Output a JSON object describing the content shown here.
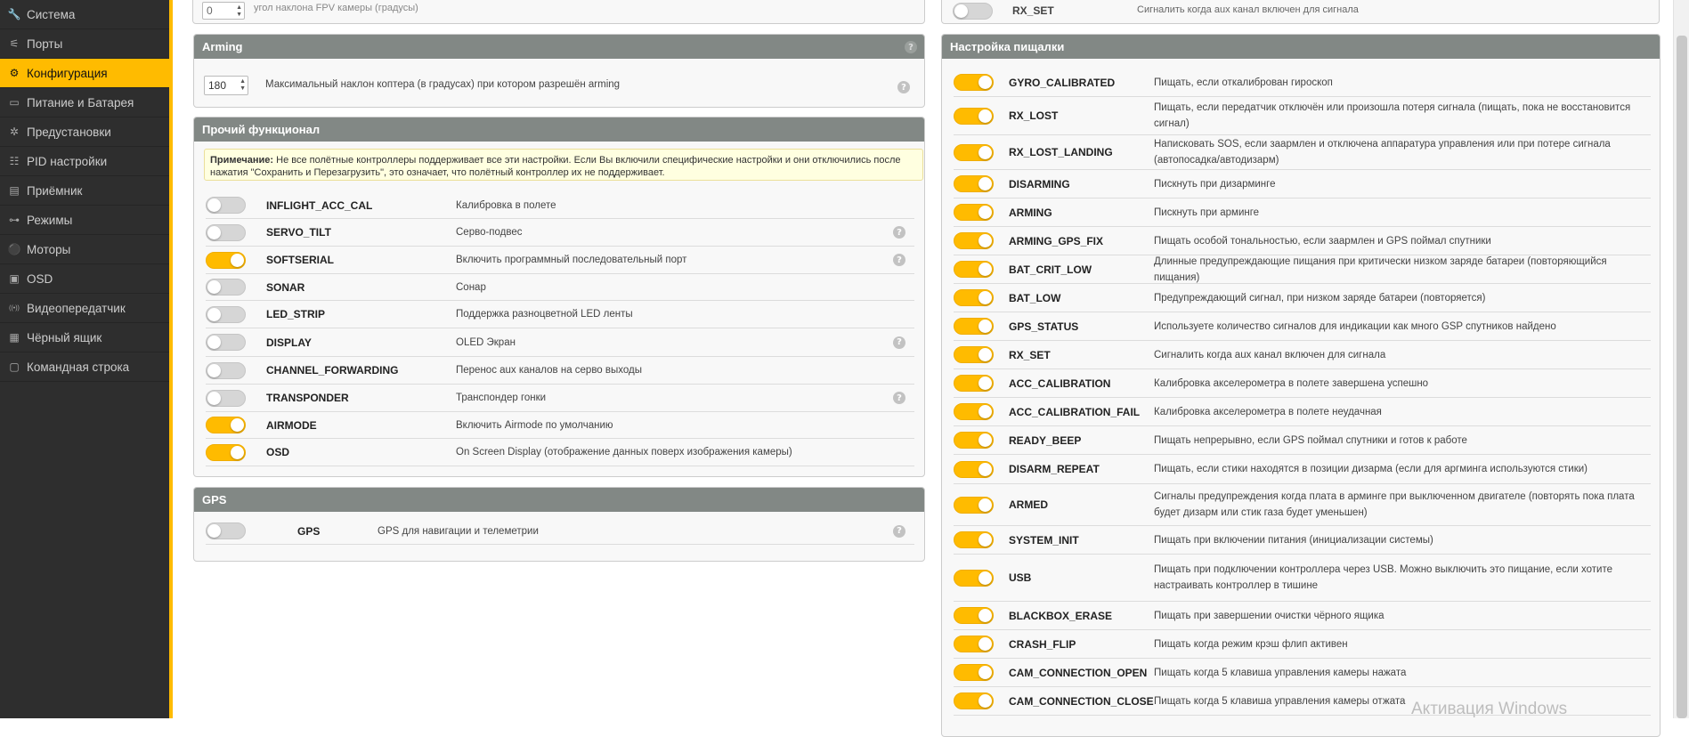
{
  "sidebar": {
    "items": [
      {
        "label": "Система",
        "icon": "wrench-icon"
      },
      {
        "label": "Порты",
        "icon": "plug-icon"
      },
      {
        "label": "Конфигурация",
        "icon": "gear-icon",
        "active": true
      },
      {
        "label": "Питание и Батарея",
        "icon": "battery-icon"
      },
      {
        "label": "Предустановки",
        "icon": "wand-icon"
      },
      {
        "label": "PID настройки",
        "icon": "sliders-icon"
      },
      {
        "label": "Приёмник",
        "icon": "receiver-icon"
      },
      {
        "label": "Режимы",
        "icon": "switch-icon"
      },
      {
        "label": "Моторы",
        "icon": "motor-icon"
      },
      {
        "label": "OSD",
        "icon": "display-icon"
      },
      {
        "label": "Видеопередатчик",
        "icon": "antenna-icon"
      },
      {
        "label": "Чёрный ящик",
        "icon": "blackbox-icon"
      },
      {
        "label": "Командная строка",
        "icon": "terminal-icon"
      }
    ]
  },
  "top_left_cut": {
    "value": "0",
    "text": "угол наклона FPV камеры (градусы)"
  },
  "top_right_cut": {
    "name": "RX_SET",
    "text": "Сигналить когда aux канал включен для сигнала"
  },
  "arming": {
    "title": "Arming",
    "value": "180",
    "label": "Максимальный наклон коптера (в градусах) при котором разрешён arming"
  },
  "features": {
    "title": "Прочий функционал",
    "note_bold": "Примечание:",
    "note_text": " Не все полётные контроллеры поддерживает все эти настройки. Если Вы включили специфические настройки и они отключились после нажатия \"Сохранить и Перезагрузить\", это означает, что полётный контроллер их не поддерживает.",
    "rows": [
      {
        "name": "INFLIGHT_ACC_CAL",
        "desc": "Калибровка в полете",
        "on": false,
        "help": false
      },
      {
        "name": "SERVO_TILT",
        "desc": "Серво-подвес",
        "on": false,
        "help": true
      },
      {
        "name": "SOFTSERIAL",
        "desc": "Включить программный последовательный порт",
        "on": true,
        "help": true
      },
      {
        "name": "SONAR",
        "desc": "Сонар",
        "on": false,
        "help": false
      },
      {
        "name": "LED_STRIP",
        "desc": "Поддержка разноцветной LED ленты",
        "on": false,
        "help": false
      },
      {
        "name": "DISPLAY",
        "desc": "OLED Экран",
        "on": false,
        "help": true
      },
      {
        "name": "CHANNEL_FORWARDING",
        "desc": "Перенос aux каналов на серво выходы",
        "on": false,
        "help": false
      },
      {
        "name": "TRANSPONDER",
        "desc": "Транспондер гонки",
        "on": false,
        "help": true
      },
      {
        "name": "AIRMODE",
        "desc": "Включить Airmode по умолчанию",
        "on": true,
        "help": false
      },
      {
        "name": "OSD",
        "desc": "On Screen Display (отображение данных поверх изображения камеры)",
        "on": true,
        "help": false
      }
    ]
  },
  "gps": {
    "title": "GPS",
    "name": "GPS",
    "desc": "GPS для навигации и телеметрии",
    "on": false
  },
  "beeper": {
    "title": "Настройка пищалки",
    "rows": [
      {
        "name": "GYRO_CALIBRATED",
        "desc": "Пищать, если откалиброван гироскоп",
        "on": true
      },
      {
        "name": "RX_LOST",
        "desc": "Пищать, если передатчик отключён или произошла потеря сигнала (пищать, пока не восстановится сигнал)",
        "on": true
      },
      {
        "name": "RX_LOST_LANDING",
        "desc": "Написковать SOS, если заармлен и отключена аппаратура управления или при потере сигнала (автопосадка/автодизарм)",
        "on": true
      },
      {
        "name": "DISARMING",
        "desc": "Пискнуть при дизарминге",
        "on": true
      },
      {
        "name": "ARMING",
        "desc": "Пискнуть при арминге",
        "on": true
      },
      {
        "name": "ARMING_GPS_FIX",
        "desc": "Пищать особой тональностью, если заармлен и GPS поймал спутники",
        "on": true
      },
      {
        "name": "BAT_CRIT_LOW",
        "desc": "Длинные предупреждающие пищания при критически низком заряде батареи (повторяющийся пищания)",
        "on": true
      },
      {
        "name": "BAT_LOW",
        "desc": "Предупреждающий сигнал, при низком заряде батареи (повторяется)",
        "on": true
      },
      {
        "name": "GPS_STATUS",
        "desc": "Используете количество сигналов для индикации как много GSP спутников найдено",
        "on": true
      },
      {
        "name": "RX_SET",
        "desc": "Сигналить когда aux канал включен для сигнала",
        "on": true
      },
      {
        "name": "ACC_CALIBRATION",
        "desc": "Калибровка акселерометра в полете завершена успешно",
        "on": true
      },
      {
        "name": "ACC_CALIBRATION_FAIL",
        "desc": "Калибровка акселерометра в полете неудачная",
        "on": true
      },
      {
        "name": "READY_BEEP",
        "desc": "Пищать непрерывно, если GPS поймал спутники и готов к работе",
        "on": true
      },
      {
        "name": "DISARM_REPEAT",
        "desc": "Пищать, если стики находятся в позиции дизарма (если для аргминга используются стики)",
        "on": true
      },
      {
        "name": "ARMED",
        "desc": "Сигналы предупреждения когда плата в арминге при выключенном двигателе (повторять пока плата будет дизарм или стик газа будет уменьшен)",
        "on": true
      },
      {
        "name": "SYSTEM_INIT",
        "desc": "Пищать при включении питания (инициализации системы)",
        "on": true
      },
      {
        "name": "USB",
        "desc": "Пищать при подключении контроллера через USB. Можно выключить это пищание, если хотите настраивать контроллер в тишине",
        "on": true
      },
      {
        "name": "BLACKBOX_ERASE",
        "desc": "Пищать при завершении очистки чёрного ящика",
        "on": true
      },
      {
        "name": "CRASH_FLIP",
        "desc": "Пищать когда режим крэш флип активен",
        "on": true
      },
      {
        "name": "CAM_CONNECTION_OPEN",
        "desc": "Пищать когда 5 клавиша управления камеры нажата",
        "on": true
      },
      {
        "name": "CAM_CONNECTION_CLOSE",
        "desc": "Пищать когда 5 клавиша управления камеры отжата",
        "on": true
      }
    ]
  },
  "help_glyph": "?",
  "watermark": "Активация Windows",
  "colors": {
    "accent": "#ffbb00",
    "sidebar": "#2e2e2e",
    "panel_head": "#828885"
  }
}
